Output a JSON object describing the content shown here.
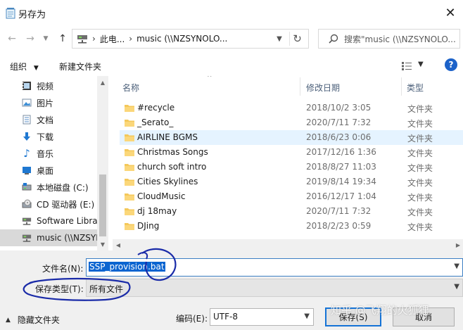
{
  "window": {
    "title": "另存为"
  },
  "nav": {
    "breadcrumb": [
      "此电...",
      "music (\\\\NZSYNOLO..."
    ],
    "search_placeholder": "搜索\"music (\\\\NZSYNOLO..."
  },
  "toolbar": {
    "organize": "组织",
    "new_folder": "新建文件夹"
  },
  "sidebar": {
    "items": [
      {
        "label": "视频",
        "icon": "video-icon"
      },
      {
        "label": "图片",
        "icon": "pictures-icon"
      },
      {
        "label": "文档",
        "icon": "documents-icon"
      },
      {
        "label": "下载",
        "icon": "download-icon"
      },
      {
        "label": "音乐",
        "icon": "music-icon"
      },
      {
        "label": "桌面",
        "icon": "desktop-icon"
      },
      {
        "label": "本地磁盘 (C:)",
        "icon": "drive-icon"
      },
      {
        "label": "CD 驱动器 (E:)",
        "icon": "cd-drive-icon"
      },
      {
        "label": "Software Library",
        "icon": "network-drive-icon"
      },
      {
        "label": "music (\\\\NZSYNOLOGY)",
        "icon": "network-drive-icon"
      }
    ]
  },
  "files": {
    "columns": [
      "名称",
      "修改日期",
      "类型"
    ],
    "rows": [
      {
        "name": "#recycle",
        "date": "2018/10/2 3:05",
        "type": "文件夹"
      },
      {
        "name": "_Serato_",
        "date": "2020/7/11 7:32",
        "type": "文件夹"
      },
      {
        "name": "AIRLINE BGMS",
        "date": "2018/6/23 0:06",
        "type": "文件夹"
      },
      {
        "name": "Christmas Songs",
        "date": "2017/12/16 1:36",
        "type": "文件夹"
      },
      {
        "name": "church soft intro",
        "date": "2018/8/27 11:03",
        "type": "文件夹"
      },
      {
        "name": "Cities Skylines",
        "date": "2019/8/14 19:34",
        "type": "文件夹"
      },
      {
        "name": "CloudMusic",
        "date": "2016/12/17 1:04",
        "type": "文件夹"
      },
      {
        "name": "dj 18may",
        "date": "2020/7/11 7:32",
        "type": "文件夹"
      },
      {
        "name": "DJing",
        "date": "2018/2/23 0:59",
        "type": "文件夹"
      }
    ]
  },
  "form": {
    "filename_label": "文件名(N):",
    "filename_value": "SSP_provision.bat",
    "filetype_label": "保存类型(T):",
    "filetype_value": "所有文件",
    "hide_folders": "隐藏文件夹",
    "encoding_label": "编码(E):",
    "encoding_value": "UTF-8",
    "save": "保存(S)",
    "cancel": "取消"
  },
  "watermark": "知乎 @飞翔的火狐狸",
  "colors": {
    "accent": "#0a64d0",
    "hover_row": "#e5f3ff",
    "folder": "#f4c85a",
    "annotation_ink": "#1a2ba8"
  }
}
